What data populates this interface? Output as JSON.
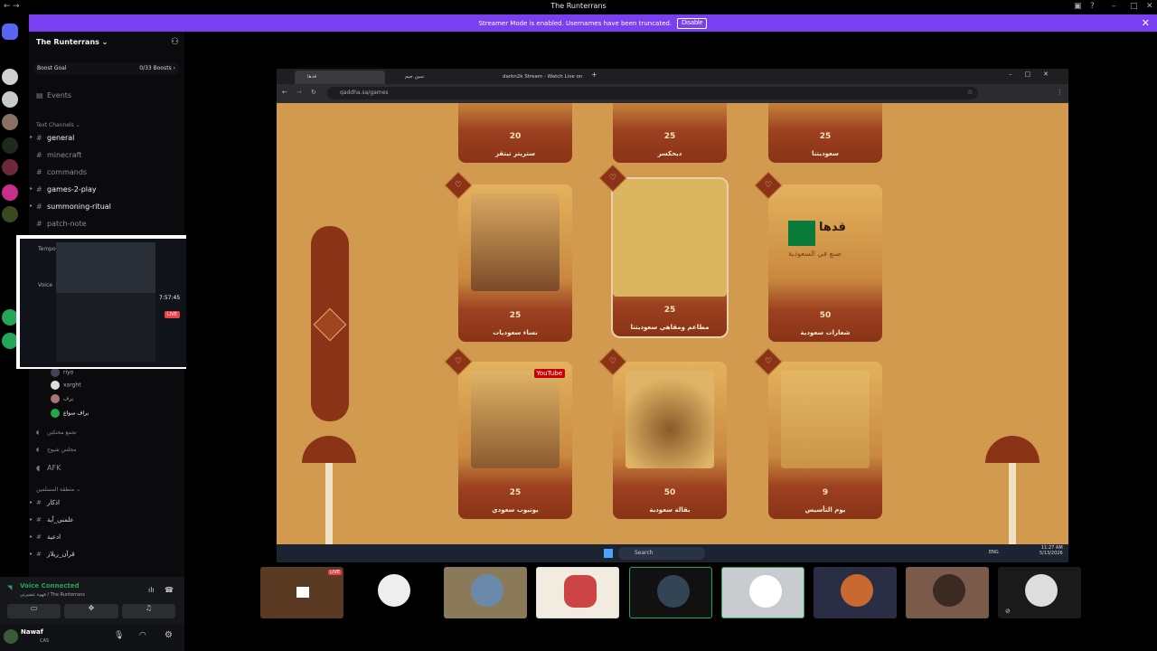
{
  "window": {
    "title": "The Runterrans"
  },
  "banner": {
    "text": "Streamer Mode is enabled. Usernames have been truncated.",
    "button": "Disable"
  },
  "server": {
    "name": "The Runterrans ⌄",
    "boost_label": "Boost Goal",
    "boost_count": "0/33 Boosts ›"
  },
  "sidebar": {
    "events": "Events",
    "text_channels_header": "Text Channels ⌄",
    "channels": [
      "general",
      "minecraft",
      "commands",
      "games-2-play",
      "summoning-ritual",
      "patch-note"
    ],
    "voice_header": "Voice",
    "temp_header": "Tempo",
    "voice_users": [
      "riyo",
      "xarght",
      "برف",
      "براف سواع"
    ],
    "voice_channels": [
      "تجمع محتكين",
      "مجلس شيوخ",
      "AFK"
    ],
    "extra_category": "منطقة المسلمين ⌄",
    "extra_channels": [
      "اذكار",
      "علمني_آية",
      "ادعية",
      "قرآن_ريلاز"
    ]
  },
  "popout": {
    "time": "7:57:45",
    "live": "LIVE"
  },
  "voice": {
    "status": "Voice Connected",
    "channel": "قهوة عشيرتي / The Runterrans"
  },
  "user": {
    "name": "Nawaf",
    "status": "CAS"
  },
  "browser": {
    "tabs": [
      "قدها",
      "سين جيم",
      "darkn2k Stream - Watch Live on"
    ],
    "url": "qaddha.sa/games"
  },
  "cards_top": [
    {
      "num": "20",
      "label": "ستريتر تيتقز"
    },
    {
      "num": "25",
      "label": "ديحكسر"
    },
    {
      "num": "25",
      "label": "سعوديتنا"
    }
  ],
  "cards_mid": [
    {
      "num": "25",
      "label": "نساء سعوديات"
    },
    {
      "num": "25",
      "label": "مطاعم ومقاهي سعوديتنا"
    },
    {
      "num": "50",
      "label": "شعارات سعودية"
    }
  ],
  "cards_bot": [
    {
      "num": "25",
      "label": "يوتيوب سعودي"
    },
    {
      "num": "50",
      "label": "بقالة سعودية"
    },
    {
      "num": "9",
      "label": "يوم التأسيس"
    }
  ],
  "card_mid3_text": "قدها",
  "card_mid3_sub": "صنع في السعودية",
  "youtube_badge": "YouTube",
  "taskbar": {
    "search": "Search",
    "lang": "ENG",
    "time": "11:27 AM",
    "date": "5/13/2026"
  },
  "strip": {
    "live": "LIVE"
  },
  "colors": {
    "accent": "#7b3ff2",
    "live": "#ed4245",
    "voice_green": "#23a55a",
    "page_bg": "#d29a4f"
  }
}
